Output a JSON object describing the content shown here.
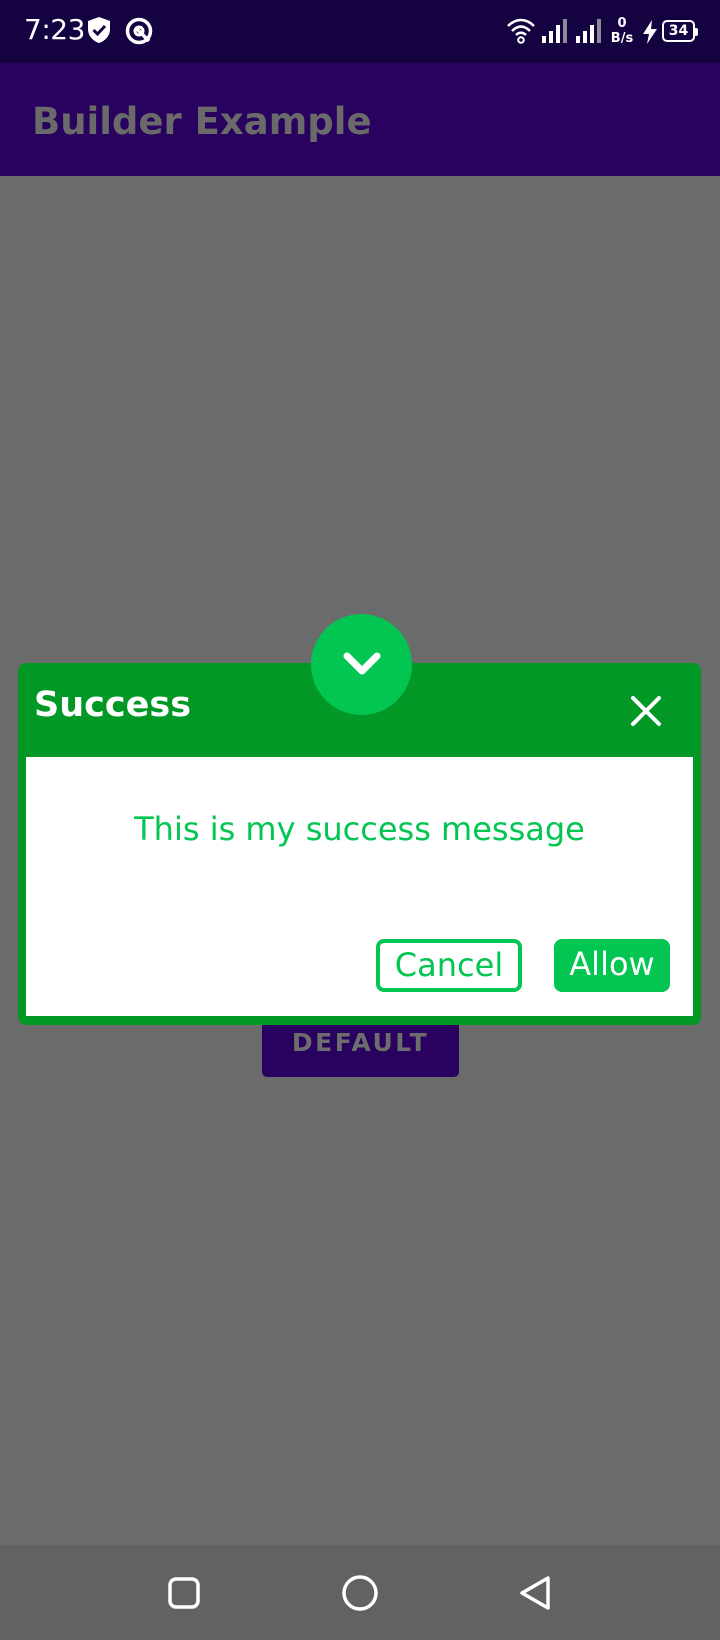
{
  "status_bar": {
    "time": "7:23",
    "net_speed_value": "0",
    "net_speed_unit": "B/s",
    "battery_level": "34",
    "icons": [
      "shield-check-icon",
      "sync-icon",
      "wifi-icon",
      "signal-icon",
      "signal-icon",
      "charging-icon",
      "battery-icon"
    ]
  },
  "app_bar": {
    "title": "Builder Example"
  },
  "background_button": {
    "label": "DEFAULT"
  },
  "dialog": {
    "title": "Success",
    "message": "This is my success message",
    "cancel_label": "Cancel",
    "allow_label": "Allow",
    "badge_icon": "chevron-down-icon",
    "close_icon": "close-icon"
  },
  "colors": {
    "status_bar_bg": "#150240",
    "app_bar_bg": "#28025e",
    "scrim": "#6b6b6b",
    "dialog_header": "#029825",
    "accent_green": "#03c552",
    "nav_bar_bg": "#626262"
  },
  "nav_bar": {
    "icons": [
      "recent-apps-icon",
      "home-icon",
      "back-icon"
    ]
  }
}
